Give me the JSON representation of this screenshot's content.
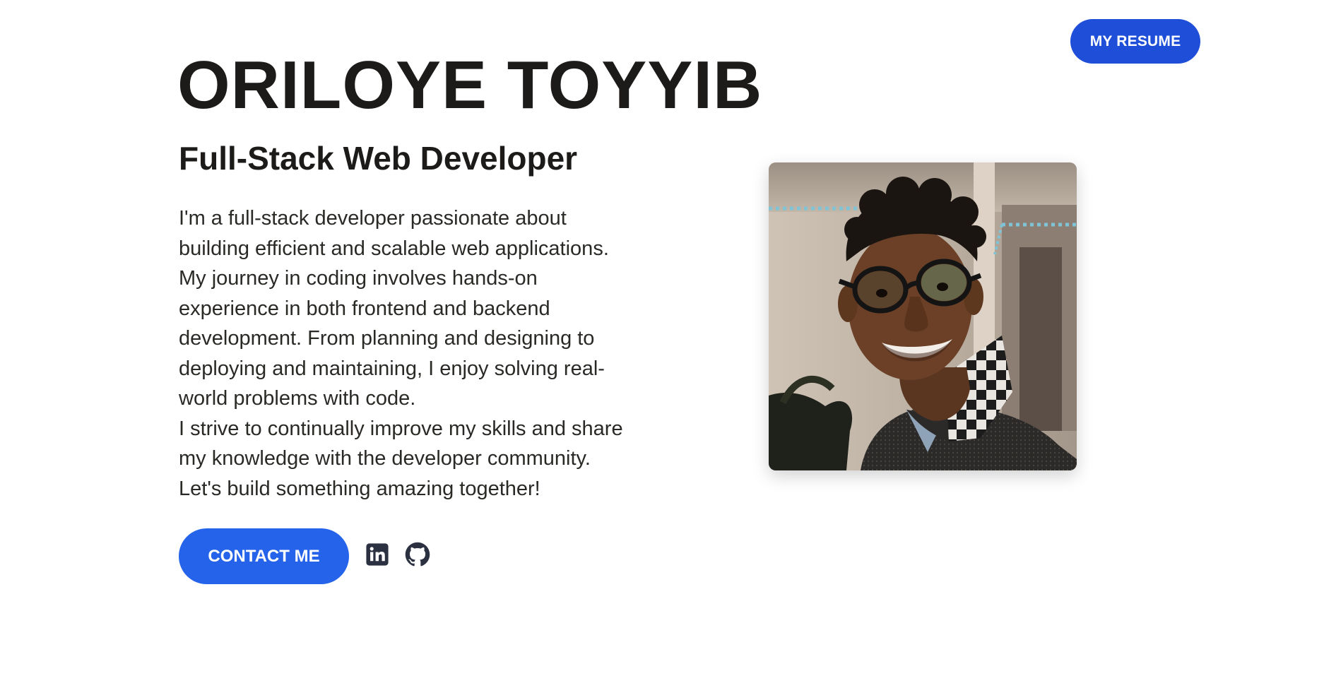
{
  "header": {
    "resume_label": "MY RESUME"
  },
  "hero": {
    "name": "ORILOYE TOYYIB",
    "role": "Full-Stack Web Developer",
    "bio_lines": [
      "I'm a full-stack developer passionate about",
      "building efficient and scalable web applications.",
      "My journey in coding involves hands-on",
      "experience in both frontend and backend",
      "development. From planning and designing to",
      "deploying and maintaining, I enjoy solving real-",
      "world problems with code.",
      "I strive to continually improve my skills and share",
      "my knowledge with the developer community.",
      "Let's build something amazing together!"
    ],
    "contact_label": "CONTACT ME"
  },
  "social": {
    "icons": [
      "linkedin-icon",
      "github-icon"
    ],
    "icon_color": "#2b3140"
  },
  "colors": {
    "resume_button": "#1f4fd8",
    "contact_button": "#2563eb",
    "text": "#1c1b1a"
  }
}
